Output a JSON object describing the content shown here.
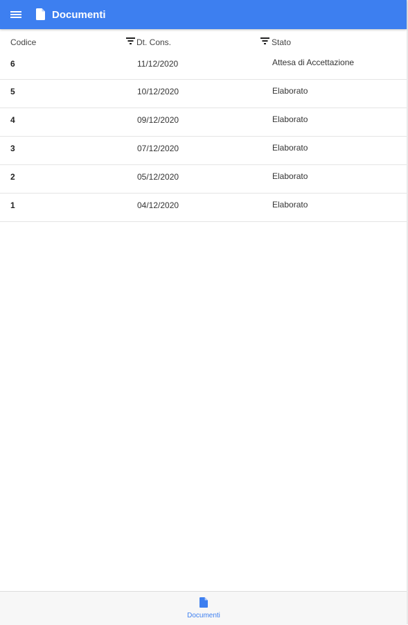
{
  "header": {
    "title": "Documenti",
    "menu_icon": "menu-icon",
    "title_icon": "document-icon",
    "accent_color": "#3d7ff0"
  },
  "table": {
    "columns": [
      {
        "label": "Codice",
        "filterable": false
      },
      {
        "label": "Dt. Cons.",
        "filterable": true,
        "icon": "filter-icon"
      },
      {
        "label": "Stato",
        "filterable": true,
        "icon": "filter-icon"
      }
    ],
    "rows": [
      {
        "code": "6",
        "date": "11/12/2020",
        "state": "Attesa di Accettazione"
      },
      {
        "code": "5",
        "date": "10/12/2020",
        "state": "Elaborato"
      },
      {
        "code": "4",
        "date": "09/12/2020",
        "state": "Elaborato"
      },
      {
        "code": "3",
        "date": "07/12/2020",
        "state": "Elaborato"
      },
      {
        "code": "2",
        "date": "05/12/2020",
        "state": "Elaborato"
      },
      {
        "code": "1",
        "date": "04/12/2020",
        "state": "Elaborato"
      }
    ]
  },
  "bottom_nav": {
    "items": [
      {
        "label": "Documenti",
        "icon": "document-icon",
        "active": true
      }
    ]
  }
}
